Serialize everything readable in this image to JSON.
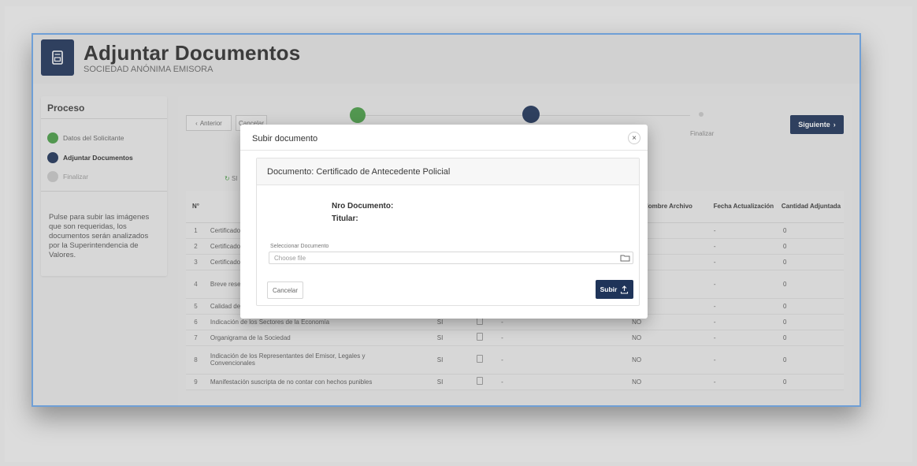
{
  "header": {
    "title": "Adjuntar Documentos",
    "subtitle": "SOCIEDAD ANÓNIMA EMISORA"
  },
  "sidebar": {
    "title": "Proceso",
    "steps": [
      {
        "label": "Datos del Solicitante",
        "state": "done"
      },
      {
        "label": "Adjuntar Documentos",
        "state": "current"
      },
      {
        "label": "Finalizar",
        "state": "pending"
      }
    ],
    "help_text": "Pulse     para subir las imágenes que son requeridas, los documentos serán analizados por la Superintendencia de Valores."
  },
  "toolbar": {
    "anterior_label": "Anterior",
    "cancelar_label": "Cancelar",
    "siguiente_label": "Siguiente",
    "stepper_finalizar_label": "Finalizar",
    "si_label": "SI"
  },
  "table": {
    "headers": {
      "num": "N°",
      "nombre_archivo": "Nombre Archivo",
      "fecha": "Fecha Actualización",
      "cantidad": "Cantidad Adjuntada"
    },
    "rows": [
      {
        "num": "1",
        "doc": "Certificado de",
        "req": "",
        "archivo": "",
        "adjunto": "",
        "fecha": "-",
        "cantidad": "0"
      },
      {
        "num": "2",
        "doc": "Certificado de",
        "req": "",
        "archivo": "",
        "adjunto": "",
        "fecha": "-",
        "cantidad": "0"
      },
      {
        "num": "3",
        "doc": "Certificado de",
        "req": "",
        "archivo": "",
        "adjunto": "",
        "fecha": "-",
        "cantidad": "0"
      },
      {
        "num": "4",
        "doc": "Breve reseña h interés a inver",
        "req": "",
        "archivo": "",
        "adjunto": "",
        "fecha": "-",
        "cantidad": "0"
      },
      {
        "num": "5",
        "doc": "Calidad de M",
        "req": "",
        "archivo": "",
        "adjunto": "",
        "fecha": "-",
        "cantidad": "0"
      },
      {
        "num": "6",
        "doc": "Indicación de los Sectores de la Economía",
        "req": "SI",
        "archivo": "-",
        "adjunto": "NO",
        "fecha": "-",
        "cantidad": "0"
      },
      {
        "num": "7",
        "doc": "Organigrama de la Sociedad",
        "req": "SI",
        "archivo": "-",
        "adjunto": "NO",
        "fecha": "-",
        "cantidad": "0"
      },
      {
        "num": "8",
        "doc": "Indicación de los Representantes del Emisor, Legales y Convencionales",
        "req": "SI",
        "archivo": "-",
        "adjunto": "NO",
        "fecha": "-",
        "cantidad": "0"
      },
      {
        "num": "9",
        "doc": "Manifestación suscripta de no contar con hechos punibles",
        "req": "SI",
        "archivo": "-",
        "adjunto": "NO",
        "fecha": "-",
        "cantidad": "0"
      }
    ]
  },
  "modal": {
    "title": "Subir documento",
    "document_title": "Documento: Certificado de Antecedente Policial",
    "nro_documento_label": "Nro Documento:",
    "titular_label": "Titular:",
    "field_label": "Seleccionar Documento",
    "file_placeholder": "Choose file",
    "cancel_label": "Cancelar",
    "submit_label": "Subir"
  },
  "colors": {
    "navy": "#1f3459",
    "success": "#4a9e47",
    "accent_border": "#6f9fd6"
  }
}
